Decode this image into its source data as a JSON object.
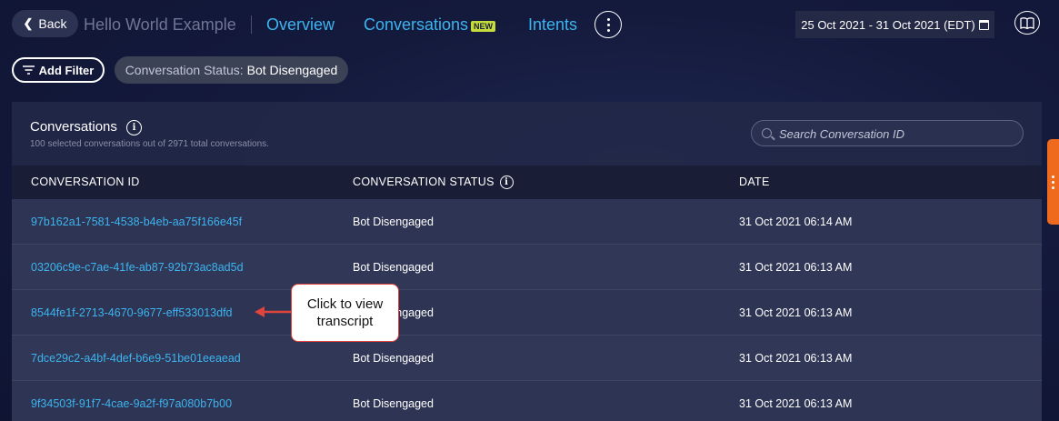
{
  "header": {
    "back_label": "Back",
    "app_title": "Hello World Example",
    "nav": {
      "overview": "Overview",
      "conversations": "Conversations",
      "new_badge": "NEW",
      "intents": "Intents"
    },
    "date_range": "25 Oct 2021 - 31 Oct 2021 (EDT)"
  },
  "filters": {
    "add_filter_label": "Add Filter",
    "chip_label": "Conversation Status:",
    "chip_value": "Bot Disengaged"
  },
  "panel": {
    "title": "Conversations",
    "subtitle": "100 selected conversations out of 2971 total conversations.",
    "search_placeholder": "Search Conversation ID",
    "columns": {
      "id": "CONVERSATION ID",
      "status": "CONVERSATION STATUS",
      "date": "DATE"
    },
    "rows": [
      {
        "id": "97b162a1-7581-4538-b4eb-aa75f166e45f",
        "status": "Bot Disengaged",
        "date": "31 Oct 2021 06:14 AM"
      },
      {
        "id": "03206c9e-c7ae-41fe-ab87-92b73ac8ad5d",
        "status": "Bot Disengaged",
        "date": "31 Oct 2021 06:13 AM"
      },
      {
        "id": "8544fe1f-2713-4670-9677-eff533013dfd",
        "status": "Bot Disengaged",
        "date": "31 Oct 2021 06:13 AM"
      },
      {
        "id": "7dce29c2-a4bf-4def-b6e9-51be01eeaead",
        "status": "Bot Disengaged",
        "date": "31 Oct 2021 06:13 AM"
      },
      {
        "id": "9f34503f-91f7-4cae-9a2f-f97a080b7b00",
        "status": "Bot Disengaged",
        "date": "31 Oct 2021 06:13 AM"
      }
    ]
  },
  "annotation": {
    "callout_text": "Click to view transcript",
    "accent_color": "#e0443c"
  },
  "colors": {
    "link": "#3cb4f0",
    "badge": "#c5dc3a",
    "side_tab": "#f06a1e"
  }
}
